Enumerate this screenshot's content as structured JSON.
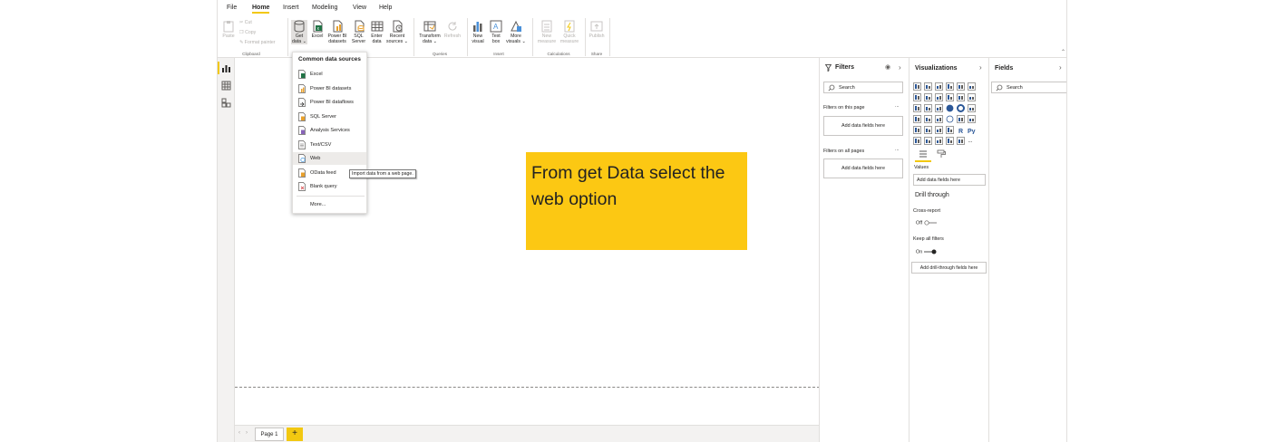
{
  "menu": [
    "File",
    "Home",
    "Insert",
    "Modeling",
    "View",
    "Help"
  ],
  "clipboard": {
    "paste": "Paste",
    "cut": "Cut",
    "copy": "Copy",
    "format_painter": "Format painter",
    "group": "Clipboard"
  },
  "data_buttons": [
    {
      "l1": "Get",
      "l2": "data ⌄"
    },
    {
      "l1": "Excel",
      "l2": ""
    },
    {
      "l1": "Power BI",
      "l2": "datasets"
    },
    {
      "l1": "SQL",
      "l2": "Server"
    },
    {
      "l1": "Enter",
      "l2": "data"
    },
    {
      "l1": "Recent",
      "l2": "sources ⌄"
    }
  ],
  "queries": {
    "transform_l1": "Transform",
    "transform_l2": "data ⌄",
    "refresh": "Refresh",
    "group": "Queries"
  },
  "insert": {
    "new_l1": "New",
    "new_l2": "visual",
    "text_l1": "Text",
    "text_l2": "box",
    "more_l1": "More",
    "more_l2": "visuals ⌄",
    "group": "Insert"
  },
  "calculations": {
    "new_l1": "New",
    "new_l2": "measure",
    "quick_l1": "Quick",
    "quick_l2": "measure",
    "group": "Calculations"
  },
  "share": {
    "publish": "Publish",
    "group": "Share"
  },
  "dropdown": {
    "title": "Common data sources",
    "items": [
      "Excel",
      "Power BI datasets",
      "Power BI dataflows",
      "SQL Server",
      "Analysis Services",
      "Text/CSV",
      "Web",
      "OData feed",
      "Blank query"
    ],
    "more": "More...",
    "tooltip": "Import data from a web page."
  },
  "callout": "From get Data select the web option",
  "pages": {
    "tab": "Page 1",
    "add": "+"
  },
  "filters": {
    "title": "Filters",
    "search": "Search",
    "on_this_page": "Filters on this page",
    "on_all_pages": "Filters on all pages",
    "add_fields": "Add data fields here",
    "more": "..."
  },
  "visualizations": {
    "title": "Visualizations",
    "values_label": "Values",
    "add_fields": "Add data fields here",
    "drill_through": "Drill through",
    "cross_report": "Cross-report",
    "cross_report_state": "Off",
    "keep_filters": "Keep all filters",
    "keep_filters_state": "On",
    "add_drill": "Add drill-through fields here",
    "r_label": "R",
    "py_label": "Py",
    "more": "..."
  },
  "fields": {
    "title": "Fields",
    "search": "Search"
  },
  "colors": {
    "accent": "#f2c811",
    "callout": "#fcc813",
    "excel": "#217346",
    "pbi": "#e8a02c"
  }
}
